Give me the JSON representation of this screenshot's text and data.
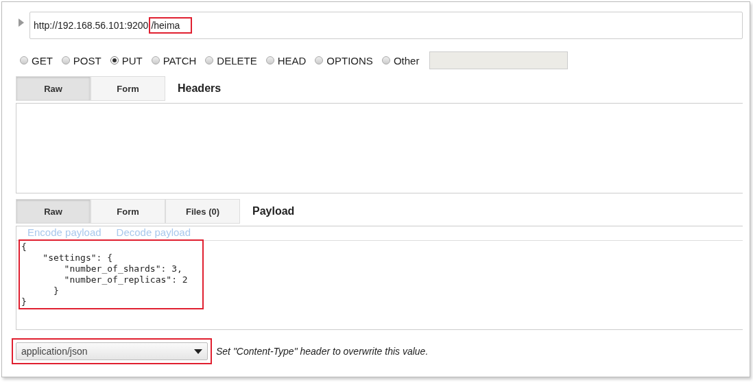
{
  "url": {
    "base": "http://192.168.56.101:9200",
    "highlighted": "/heima"
  },
  "methods": [
    {
      "label": "GET",
      "selected": false
    },
    {
      "label": "POST",
      "selected": false
    },
    {
      "label": "PUT",
      "selected": true
    },
    {
      "label": "PATCH",
      "selected": false
    },
    {
      "label": "DELETE",
      "selected": false
    },
    {
      "label": "HEAD",
      "selected": false
    },
    {
      "label": "OPTIONS",
      "selected": false
    },
    {
      "label": "Other",
      "selected": false
    }
  ],
  "headers": {
    "tabs": [
      {
        "label": "Raw",
        "selected": true
      },
      {
        "label": "Form",
        "selected": false
      }
    ],
    "title": "Headers"
  },
  "payload": {
    "tabs": [
      {
        "label": "Raw",
        "selected": true
      },
      {
        "label": "Form",
        "selected": false
      },
      {
        "label": "Files (0)",
        "selected": false
      }
    ],
    "title": "Payload",
    "links": [
      "Encode payload",
      "Decode payload"
    ],
    "code": "{\n    \"settings\": {\n        \"number_of_shards\": 3,\n        \"number_of_replicas\": 2\n      }\n}"
  },
  "content_type": {
    "value": "application/json",
    "note": "Set \"Content-Type\" header to overwrite this value."
  }
}
